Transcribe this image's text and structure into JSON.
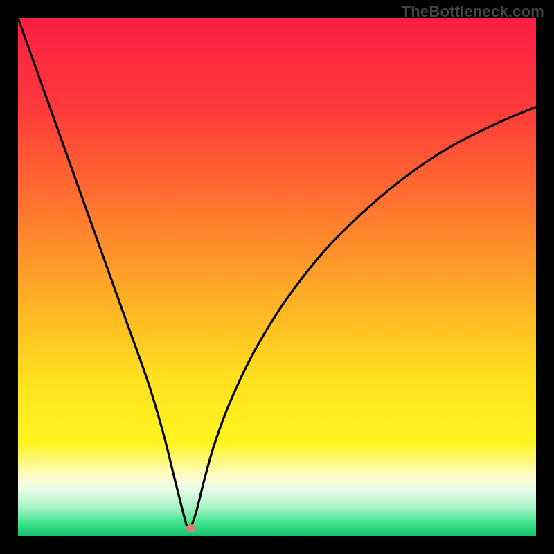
{
  "watermark": "TheBottleneck.com",
  "chart_data": {
    "type": "line",
    "title": "",
    "xlabel": "",
    "ylabel": "",
    "xlim": [
      0,
      100
    ],
    "ylim": [
      0,
      100
    ],
    "curve": {
      "name": "bottleneck-curve",
      "x": [
        0,
        5,
        10,
        15,
        20,
        25,
        28,
        30,
        31.5,
        32.5,
        33,
        33.5,
        34.5,
        36,
        38,
        41,
        45,
        50,
        55,
        60,
        65,
        70,
        75,
        80,
        85,
        90,
        95,
        100
      ],
      "y": [
        100,
        86,
        72,
        58,
        44,
        30,
        20,
        12,
        6,
        2.2,
        1.2,
        2.0,
        5,
        11,
        18,
        26,
        34.5,
        43,
        50,
        56,
        61,
        65.5,
        69.5,
        73,
        76,
        78.5,
        80.8,
        82.8
      ]
    },
    "marker": {
      "x": 33.4,
      "y": 1.5,
      "color": "#d5846e"
    },
    "gradient_stops": [
      {
        "offset": 0.0,
        "color": "#ff1e44"
      },
      {
        "offset": 0.18,
        "color": "#ff3b3a"
      },
      {
        "offset": 0.38,
        "color": "#ff7a2e"
      },
      {
        "offset": 0.55,
        "color": "#ffb225"
      },
      {
        "offset": 0.7,
        "color": "#ffe11f"
      },
      {
        "offset": 0.82,
        "color": "#fff51f"
      },
      {
        "offset": 0.885,
        "color": "#fdfccb"
      },
      {
        "offset": 0.91,
        "color": "#e9fbe7"
      },
      {
        "offset": 0.945,
        "color": "#a6f3c6"
      },
      {
        "offset": 0.975,
        "color": "#3fe38d"
      },
      {
        "offset": 1.0,
        "color": "#17c26d"
      }
    ]
  }
}
